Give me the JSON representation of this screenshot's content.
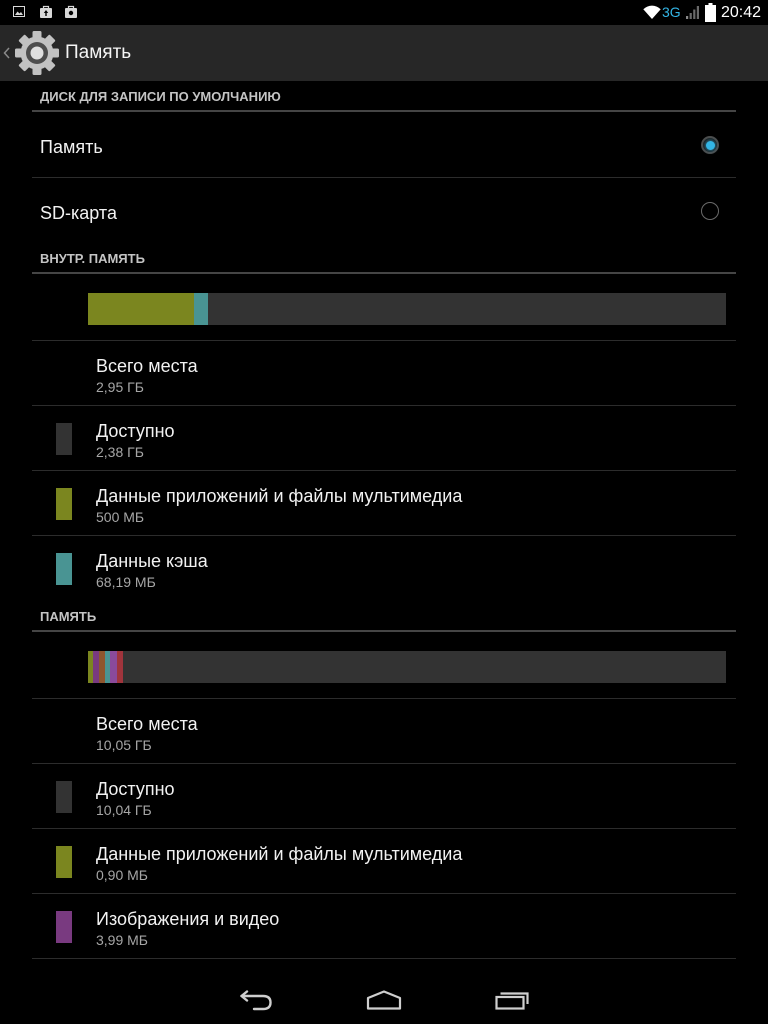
{
  "theme": {
    "accent": "#33b5e5",
    "background": "#000000",
    "action_bar": "#272727"
  },
  "status_bar": {
    "notification_icons": [
      "picture-icon",
      "shopping-bag-icon",
      "briefcase-icon"
    ],
    "wifi_icon": "wifi-icon",
    "network": "3G",
    "signal_icon": "signal-strength-icon",
    "battery_icon": "battery-icon",
    "time": "20:42"
  },
  "action_bar": {
    "up_icon": "chevron-left-icon",
    "app_icon": "settings-gear-icon",
    "title": "Память"
  },
  "default_disk": {
    "header": "ДИСК ДЛЯ ЗАПИСИ ПО УМОЛЧАНИЮ",
    "options": [
      {
        "label": "Память",
        "selected": true
      },
      {
        "label": "SD-карта",
        "selected": false
      }
    ]
  },
  "internal_storage": {
    "header": "ВНУТР. ПАМЯТЬ",
    "usage_bar": {
      "background": "#333333",
      "segments": [
        {
          "fraction": 0.166,
          "color": "#7b861f"
        },
        {
          "fraction": 0.022,
          "color": "#499493"
        }
      ]
    },
    "items": [
      {
        "title": "Всего места",
        "value": "2,95 ГБ"
      },
      {
        "title": "Доступно",
        "value": "2,38 ГБ",
        "color": "#333333"
      },
      {
        "title": "Данные приложений и файлы мультимедиа",
        "value": "500 МБ",
        "color": "#7b861f"
      },
      {
        "title": "Данные кэша",
        "value": "68,19 МБ",
        "color": "#499493"
      }
    ]
  },
  "storage": {
    "header": "ПАМЯТЬ",
    "usage_bar": {
      "background": "#333333",
      "segments": [
        {
          "fraction": 0.008,
          "color": "#7b861f"
        },
        {
          "fraction": 0.009,
          "color": "#793a80"
        },
        {
          "fraction": 0.009,
          "color": "#8e562e"
        },
        {
          "fraction": 0.009,
          "color": "#499493"
        },
        {
          "fraction": 0.011,
          "color": "#8a4a9a"
        },
        {
          "fraction": 0.009,
          "color": "#a0343c"
        }
      ]
    },
    "items": [
      {
        "title": "Всего места",
        "value": "10,05 ГБ"
      },
      {
        "title": "Доступно",
        "value": "10,04 ГБ",
        "color": "#333333"
      },
      {
        "title": "Данные приложений и файлы мультимедиа",
        "value": "0,90 МБ",
        "color": "#7b861f"
      },
      {
        "title": "Изображения и видео",
        "value": "3,99 МБ",
        "color": "#793a80"
      }
    ]
  },
  "nav_bar": {
    "back_icon": "back-icon",
    "home_icon": "home-icon",
    "recent_icon": "recent-apps-icon"
  }
}
